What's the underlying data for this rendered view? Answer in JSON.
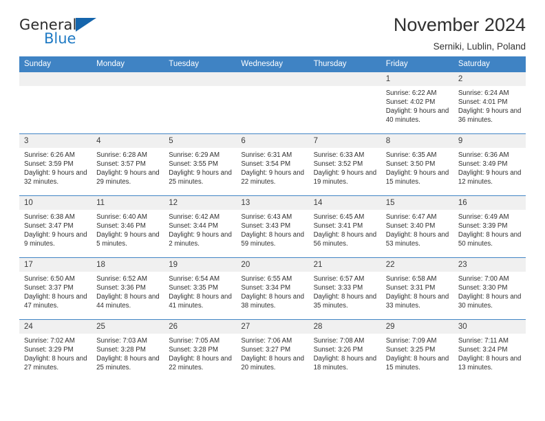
{
  "brand": {
    "name_part1": "General",
    "name_part2": "Blue",
    "accent_color": "#1f7ac4",
    "triangle_color": "#1565ac",
    "triangle_icon": "triangle-icon"
  },
  "header": {
    "title": "November 2024",
    "subtitle": "Serniki, Lublin, Poland"
  },
  "theme": {
    "header_row_bg": "#3f83c4",
    "daynum_bg": "#f0f0f0",
    "row_divider": "#3f83c4",
    "text": "#2f2f2f"
  },
  "calendar": {
    "weekday_headers": [
      "Sunday",
      "Monday",
      "Tuesday",
      "Wednesday",
      "Thursday",
      "Friday",
      "Saturday"
    ],
    "labels": {
      "sunrise": "Sunrise:",
      "sunset": "Sunset:",
      "daylight": "Daylight:"
    },
    "weeks": [
      [
        {
          "day": "",
          "empty": true
        },
        {
          "day": "",
          "empty": true
        },
        {
          "day": "",
          "empty": true
        },
        {
          "day": "",
          "empty": true
        },
        {
          "day": "",
          "empty": true
        },
        {
          "day": "1",
          "sunrise": "Sunrise: 6:22 AM",
          "sunset": "Sunset: 4:02 PM",
          "daylight": "Daylight: 9 hours and 40 minutes."
        },
        {
          "day": "2",
          "sunrise": "Sunrise: 6:24 AM",
          "sunset": "Sunset: 4:01 PM",
          "daylight": "Daylight: 9 hours and 36 minutes."
        }
      ],
      [
        {
          "day": "3",
          "sunrise": "Sunrise: 6:26 AM",
          "sunset": "Sunset: 3:59 PM",
          "daylight": "Daylight: 9 hours and 32 minutes."
        },
        {
          "day": "4",
          "sunrise": "Sunrise: 6:28 AM",
          "sunset": "Sunset: 3:57 PM",
          "daylight": "Daylight: 9 hours and 29 minutes."
        },
        {
          "day": "5",
          "sunrise": "Sunrise: 6:29 AM",
          "sunset": "Sunset: 3:55 PM",
          "daylight": "Daylight: 9 hours and 25 minutes."
        },
        {
          "day": "6",
          "sunrise": "Sunrise: 6:31 AM",
          "sunset": "Sunset: 3:54 PM",
          "daylight": "Daylight: 9 hours and 22 minutes."
        },
        {
          "day": "7",
          "sunrise": "Sunrise: 6:33 AM",
          "sunset": "Sunset: 3:52 PM",
          "daylight": "Daylight: 9 hours and 19 minutes."
        },
        {
          "day": "8",
          "sunrise": "Sunrise: 6:35 AM",
          "sunset": "Sunset: 3:50 PM",
          "daylight": "Daylight: 9 hours and 15 minutes."
        },
        {
          "day": "9",
          "sunrise": "Sunrise: 6:36 AM",
          "sunset": "Sunset: 3:49 PM",
          "daylight": "Daylight: 9 hours and 12 minutes."
        }
      ],
      [
        {
          "day": "10",
          "sunrise": "Sunrise: 6:38 AM",
          "sunset": "Sunset: 3:47 PM",
          "daylight": "Daylight: 9 hours and 9 minutes."
        },
        {
          "day": "11",
          "sunrise": "Sunrise: 6:40 AM",
          "sunset": "Sunset: 3:46 PM",
          "daylight": "Daylight: 9 hours and 5 minutes."
        },
        {
          "day": "12",
          "sunrise": "Sunrise: 6:42 AM",
          "sunset": "Sunset: 3:44 PM",
          "daylight": "Daylight: 9 hours and 2 minutes."
        },
        {
          "day": "13",
          "sunrise": "Sunrise: 6:43 AM",
          "sunset": "Sunset: 3:43 PM",
          "daylight": "Daylight: 8 hours and 59 minutes."
        },
        {
          "day": "14",
          "sunrise": "Sunrise: 6:45 AM",
          "sunset": "Sunset: 3:41 PM",
          "daylight": "Daylight: 8 hours and 56 minutes."
        },
        {
          "day": "15",
          "sunrise": "Sunrise: 6:47 AM",
          "sunset": "Sunset: 3:40 PM",
          "daylight": "Daylight: 8 hours and 53 minutes."
        },
        {
          "day": "16",
          "sunrise": "Sunrise: 6:49 AM",
          "sunset": "Sunset: 3:39 PM",
          "daylight": "Daylight: 8 hours and 50 minutes."
        }
      ],
      [
        {
          "day": "17",
          "sunrise": "Sunrise: 6:50 AM",
          "sunset": "Sunset: 3:37 PM",
          "daylight": "Daylight: 8 hours and 47 minutes."
        },
        {
          "day": "18",
          "sunrise": "Sunrise: 6:52 AM",
          "sunset": "Sunset: 3:36 PM",
          "daylight": "Daylight: 8 hours and 44 minutes."
        },
        {
          "day": "19",
          "sunrise": "Sunrise: 6:54 AM",
          "sunset": "Sunset: 3:35 PM",
          "daylight": "Daylight: 8 hours and 41 minutes."
        },
        {
          "day": "20",
          "sunrise": "Sunrise: 6:55 AM",
          "sunset": "Sunset: 3:34 PM",
          "daylight": "Daylight: 8 hours and 38 minutes."
        },
        {
          "day": "21",
          "sunrise": "Sunrise: 6:57 AM",
          "sunset": "Sunset: 3:33 PM",
          "daylight": "Daylight: 8 hours and 35 minutes."
        },
        {
          "day": "22",
          "sunrise": "Sunrise: 6:58 AM",
          "sunset": "Sunset: 3:31 PM",
          "daylight": "Daylight: 8 hours and 33 minutes."
        },
        {
          "day": "23",
          "sunrise": "Sunrise: 7:00 AM",
          "sunset": "Sunset: 3:30 PM",
          "daylight": "Daylight: 8 hours and 30 minutes."
        }
      ],
      [
        {
          "day": "24",
          "sunrise": "Sunrise: 7:02 AM",
          "sunset": "Sunset: 3:29 PM",
          "daylight": "Daylight: 8 hours and 27 minutes."
        },
        {
          "day": "25",
          "sunrise": "Sunrise: 7:03 AM",
          "sunset": "Sunset: 3:28 PM",
          "daylight": "Daylight: 8 hours and 25 minutes."
        },
        {
          "day": "26",
          "sunrise": "Sunrise: 7:05 AM",
          "sunset": "Sunset: 3:28 PM",
          "daylight": "Daylight: 8 hours and 22 minutes."
        },
        {
          "day": "27",
          "sunrise": "Sunrise: 7:06 AM",
          "sunset": "Sunset: 3:27 PM",
          "daylight": "Daylight: 8 hours and 20 minutes."
        },
        {
          "day": "28",
          "sunrise": "Sunrise: 7:08 AM",
          "sunset": "Sunset: 3:26 PM",
          "daylight": "Daylight: 8 hours and 18 minutes."
        },
        {
          "day": "29",
          "sunrise": "Sunrise: 7:09 AM",
          "sunset": "Sunset: 3:25 PM",
          "daylight": "Daylight: 8 hours and 15 minutes."
        },
        {
          "day": "30",
          "sunrise": "Sunrise: 7:11 AM",
          "sunset": "Sunset: 3:24 PM",
          "daylight": "Daylight: 8 hours and 13 minutes."
        }
      ]
    ]
  }
}
